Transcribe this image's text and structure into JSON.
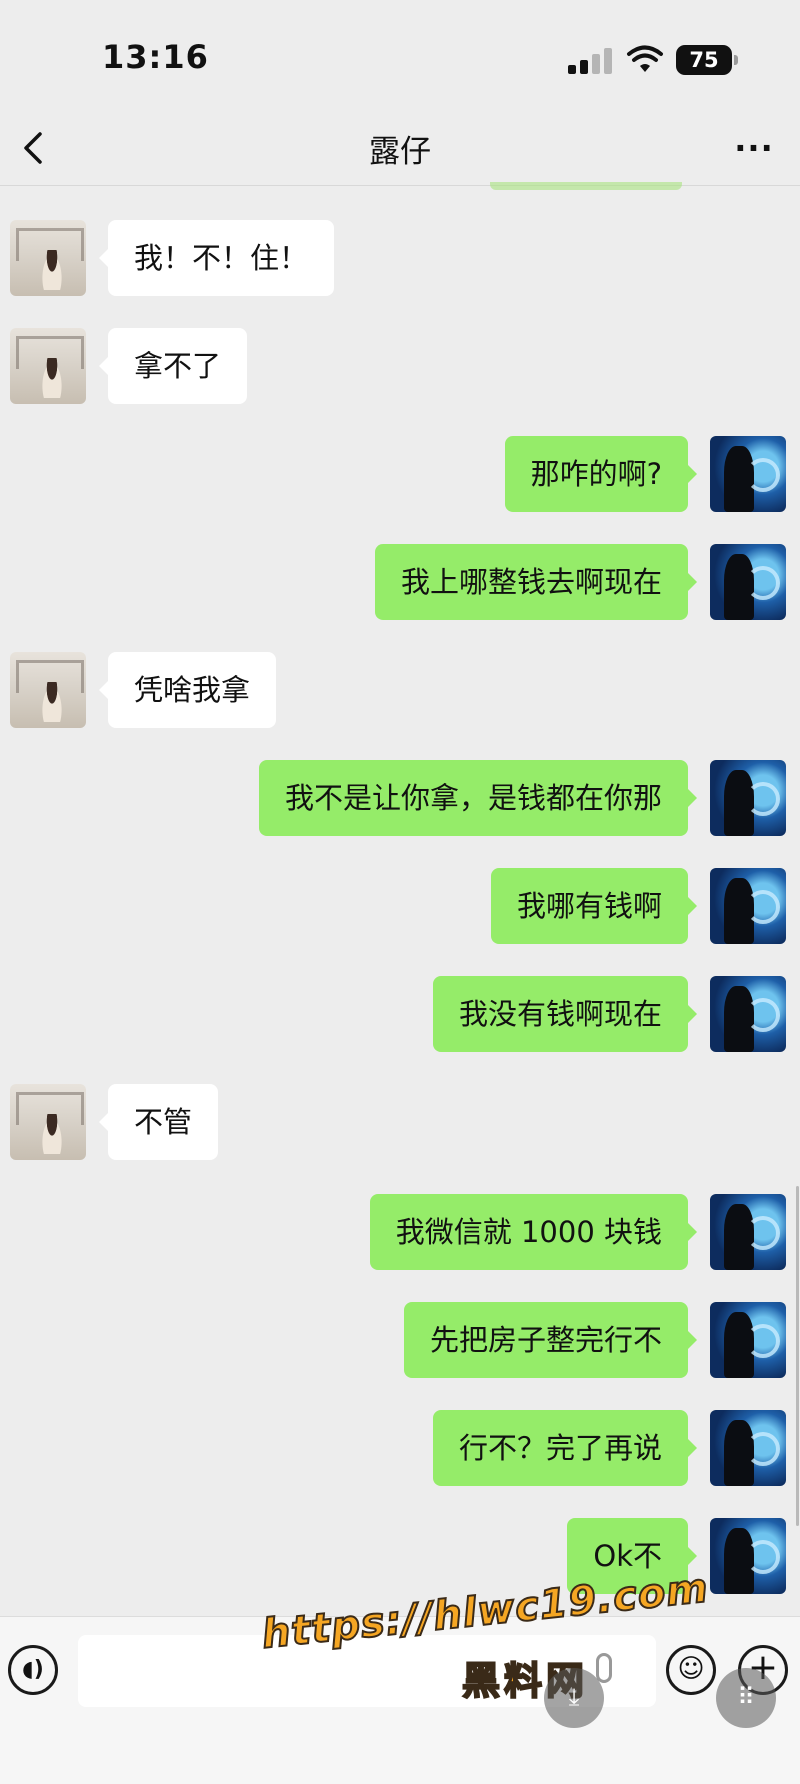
{
  "status_bar": {
    "time": "13:16",
    "battery": "75"
  },
  "header": {
    "title": "露仔"
  },
  "messages": [
    {
      "side": "left",
      "text": "我！不！住！"
    },
    {
      "side": "left",
      "text": "拿不了"
    },
    {
      "side": "right",
      "text": "那咋的啊?"
    },
    {
      "side": "right",
      "text": "我上哪整钱去啊现在"
    },
    {
      "side": "left",
      "text": "凭啥我拿"
    },
    {
      "side": "right",
      "text": "我不是让你拿，是钱都在你那"
    },
    {
      "side": "right",
      "text": "我哪有钱啊"
    },
    {
      "side": "right",
      "text": "我没有钱啊现在"
    },
    {
      "side": "left",
      "text": "不管"
    },
    {
      "side": "right",
      "text": "我微信就 1000 块钱"
    },
    {
      "side": "right",
      "text": "先把房子整完行不"
    },
    {
      "side": "right",
      "text": "行不？完了再说"
    },
    {
      "side": "right",
      "text": "Ok不"
    }
  ],
  "watermark": {
    "url": "https://hlwc19.com",
    "name": "黑料网"
  },
  "colors": {
    "bubble_right": "#95ec69",
    "bubble_left": "#ffffff",
    "background": "#ededed"
  }
}
